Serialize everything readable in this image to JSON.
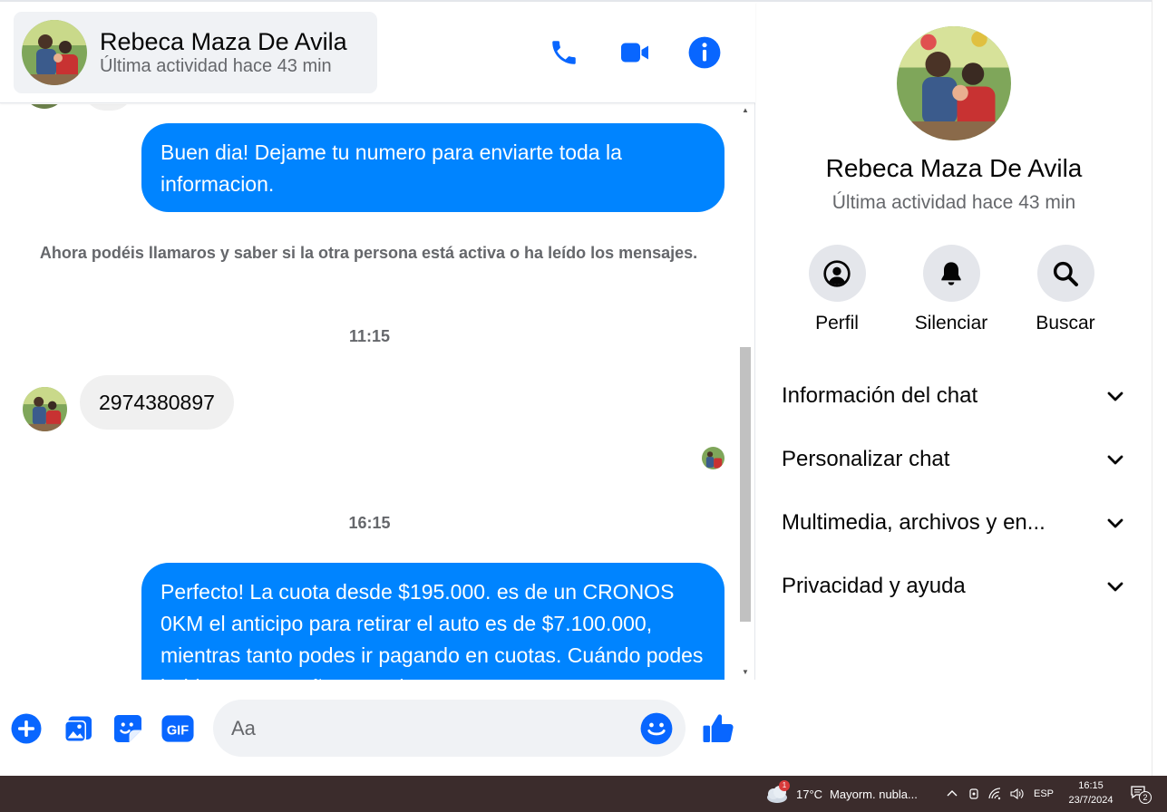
{
  "contact": {
    "name": "Rebeca Maza De Avila",
    "status": "Última actividad hace 43 min"
  },
  "messages": {
    "out_1": "Buen dia! Dejame tu numero para enviarte toda la informacion.",
    "system_note": "Ahora podéis llamaros y saber si la otra persona está activa o ha leído los mensajes.",
    "time_1": "11:15",
    "in_1": "2974380897",
    "time_2": "16:15",
    "out_2": "Perfecto! La cuota desde $195.000. es de un CRONOS 0KM el anticipo para retirar el auto es de $7.100.000, mientras tanto podes ir pagando en cuotas. Cuándo podes hablar? Acompaño para el"
  },
  "composer": {
    "placeholder": "Aa"
  },
  "panel": {
    "actions": [
      {
        "label": "Perfil",
        "icon": "profile-icon"
      },
      {
        "label": "Silenciar",
        "icon": "bell-icon"
      },
      {
        "label": "Buscar",
        "icon": "search-icon"
      }
    ],
    "sections": [
      {
        "label": "Información del chat"
      },
      {
        "label": "Personalizar chat"
      },
      {
        "label": "Multimedia, archivos y en..."
      },
      {
        "label": "Privacidad y ayuda"
      }
    ]
  },
  "taskbar": {
    "weather_badge": "1",
    "weather_temp": "17°C",
    "weather_text": "Mayorm. nubla...",
    "language": "ESP",
    "time": "16:15",
    "date": "23/7/2024",
    "notifications": "2"
  },
  "colors": {
    "accent": "#0084ff",
    "icon_blue": "#0866ff",
    "incoming_bubble": "#f0f0f0",
    "secondary_text": "#65676b",
    "taskbar": "#3b2c2c"
  }
}
